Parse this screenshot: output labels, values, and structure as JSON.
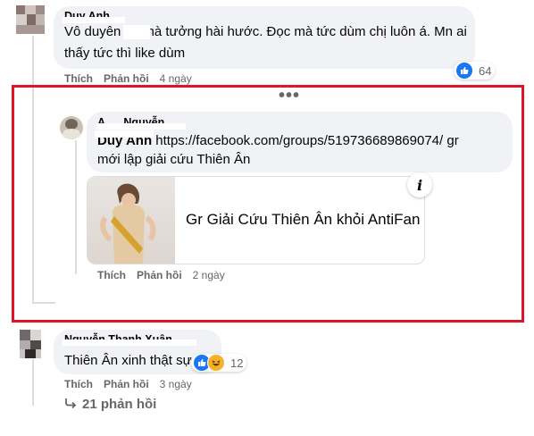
{
  "comments": [
    {
      "author": "Duy Anh",
      "text_line1": "Vô duyên      mà tưởng hài hước. Đọc mà tức dùm chị luôn á. Mn ai",
      "text_line2": "thấy tức thì like dùm",
      "like_label": "Thích",
      "reply_label": "Phản hồi",
      "time": "4 ngày",
      "reaction_count": "64"
    },
    {
      "author": "A      Nguyễn",
      "mention": "Duy Anh",
      "text_line1_rest": "https://facebook.com/groups/519736689869074/ gr",
      "text_line2": "mới lập giải cứu Thiên Ân",
      "link_title": "Gr Giải Cứu Thiên Ân khỏi AntiFan",
      "like_label": "Thích",
      "reply_label": "Phản hồi",
      "time": "2 ngày"
    },
    {
      "author": "Nguyễn Thanh Xuân",
      "text_line1": "Thiên Ân xinh thật sự",
      "like_label": "Thích",
      "reply_label": "Phản hồi",
      "time": "3 ngày",
      "reaction_count": "12"
    }
  ],
  "more_menu": "•••",
  "view_replies": "21 phản hồi",
  "colors": {
    "highlight_frame": "#e0142a",
    "bubble": "#f0f2f5",
    "secondary_text": "#65676b",
    "like_blue": "#1877f2"
  }
}
